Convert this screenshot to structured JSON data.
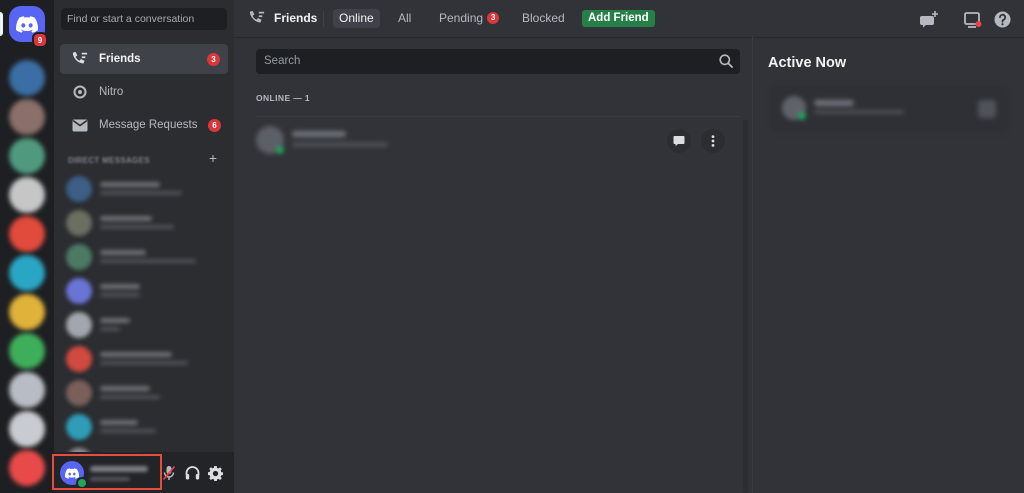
{
  "rail": {
    "home_badge": "9",
    "servers": [
      {
        "color": "#3a6ea5"
      },
      {
        "color": "#8a6f6a"
      },
      {
        "color": "#4f9a7e"
      },
      {
        "color": "#c6c6c6"
      },
      {
        "color": "#e04b3c"
      },
      {
        "color": "#2aa6c5"
      },
      {
        "color": "#e0b23a"
      },
      {
        "color": "#3fae5a"
      },
      {
        "color": "#b8bcc4"
      },
      {
        "color": "#c8ccd2"
      },
      {
        "color": "#e84a4a"
      }
    ]
  },
  "dm": {
    "search_placeholder": "Find or start a conversation",
    "nav": [
      {
        "label": "Friends",
        "badge": "3"
      },
      {
        "label": "Nitro",
        "badge": ""
      },
      {
        "label": "Message Requests",
        "badge": "6"
      }
    ],
    "header": "DIRECT MESSAGES",
    "plus": "+",
    "rows": [
      {
        "color": "#3d5e86"
      },
      {
        "color": "#6b6f60"
      },
      {
        "color": "#4c7a65"
      },
      {
        "color": "#6a74d6"
      },
      {
        "color": "#a2a6ad"
      },
      {
        "color": "#d04a3f"
      },
      {
        "color": "#7a5f5a"
      },
      {
        "color": "#2f9db8"
      },
      {
        "color": "#8d9097"
      }
    ]
  },
  "topbar": {
    "title": "Friends",
    "tabs": {
      "online": "Online",
      "all": "All",
      "pending": "Pending",
      "pending_badge": "3",
      "blocked": "Blocked",
      "add_friend": "Add Friend"
    }
  },
  "main": {
    "search_placeholder": "Search",
    "online_label": "ONLINE — 1"
  },
  "active_now": {
    "title": "Active Now"
  },
  "colors": {
    "blurple": "#5865f2",
    "green": "#248046",
    "red": "#da373c",
    "highlight": "#e74c3c"
  }
}
